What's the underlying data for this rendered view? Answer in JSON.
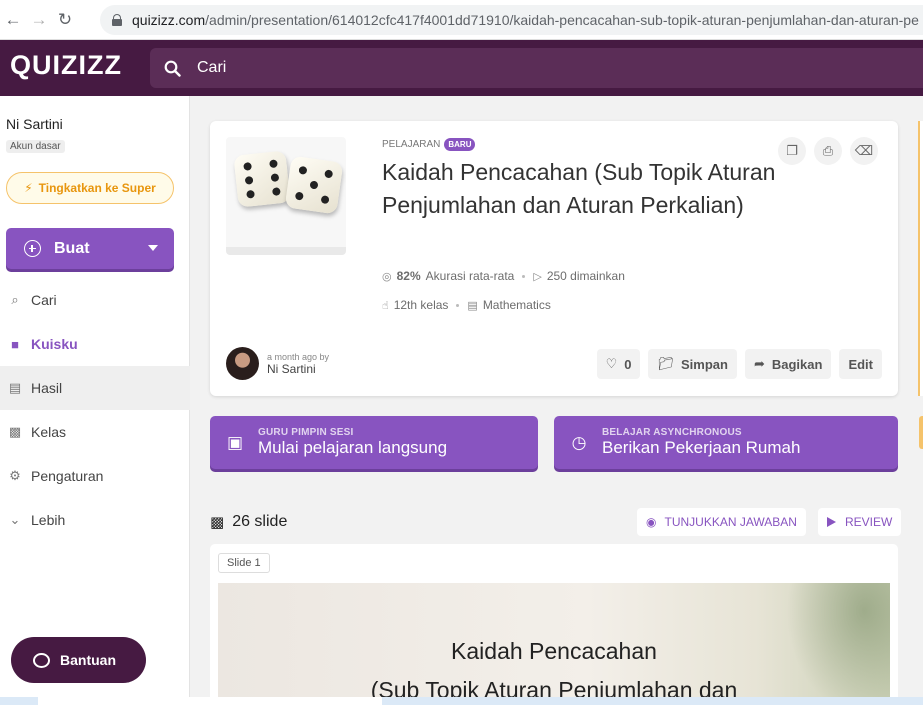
{
  "browser": {
    "url_host": "quizizz.com",
    "url_path": "/admin/presentation/614012cfc417f4001dd71910/kaidah-pencacahan-sub-topik-aturan-penjumlahan-dan-aturan-pe"
  },
  "header": {
    "logo": "QUIZIZZ",
    "search_placeholder": "Cari"
  },
  "sidebar": {
    "user_name": "Ni Sartini",
    "account_type": "Akun dasar",
    "upgrade_label": "Tingkatkan ke Super",
    "create_label": "Buat",
    "items": [
      {
        "label": "Cari",
        "icon": "search-icon"
      },
      {
        "label": "Kuisku",
        "icon": "folder-icon"
      },
      {
        "label": "Hasil",
        "icon": "chart-icon"
      },
      {
        "label": "Kelas",
        "icon": "classroom-icon"
      },
      {
        "label": "Pengaturan",
        "icon": "gear-icon"
      },
      {
        "label": "Lebih",
        "icon": "chevron-down-icon"
      }
    ],
    "help_label": "Bantuan"
  },
  "lesson": {
    "kind": "PELAJARAN",
    "badge": "BARU",
    "title": "Kaidah Pencacahan (Sub Topik Aturan Penjumlahan dan Aturan Perkalian)",
    "accuracy": "82%",
    "accuracy_label": "Akurasi rata-rata",
    "plays": "250 dimainkan",
    "grade": "12th kelas",
    "subject": "Mathematics",
    "author_time": "a month ago by",
    "author_name": "Ni Sartini",
    "likes": "0",
    "save_label": "Simpan",
    "share_label": "Bagikan",
    "edit_label": "Edit"
  },
  "actions": {
    "live_sub": "GURU PIMPIN SESI",
    "live_title": "Mulai pelajaran langsung",
    "async_sub": "BELAJAR ASYNCHRONOUS",
    "async_title": "Berikan Pekerjaan Rumah"
  },
  "slides": {
    "count_label": "26 slide",
    "show_answers": "TUNJUKKAN JAWABAN",
    "review": "REVIEW",
    "first_label": "Slide 1",
    "first_line1": "Kaidah Pencacahan",
    "first_line2": "(Sub Topik Aturan Penjumlahan dan"
  },
  "colors": {
    "brand_dark": "#461a42",
    "accent_purple": "#8854c0",
    "upgrade_orange": "#e8960e"
  }
}
